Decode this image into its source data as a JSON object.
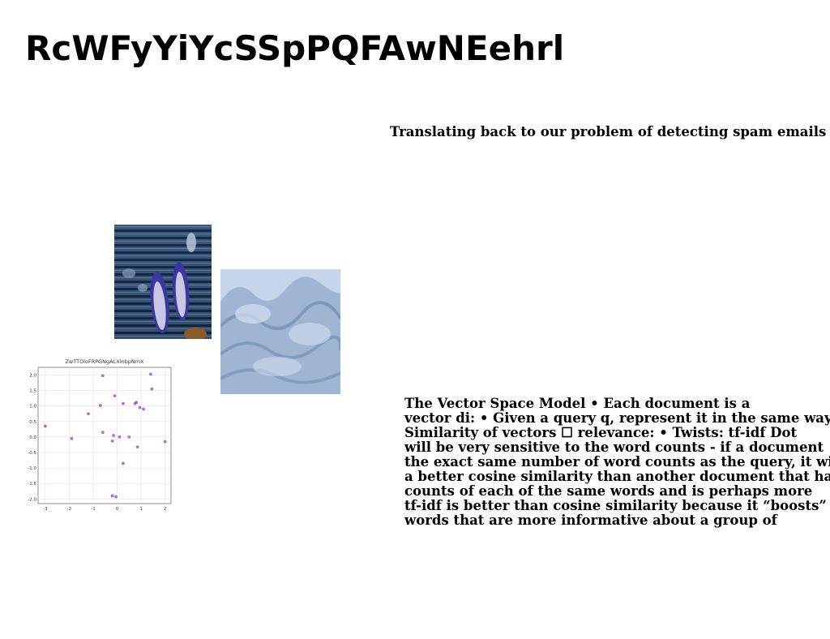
{
  "slide": {
    "title": "RcWFyYiYcSSpPQFAwNEehrl",
    "subtitle": "Translating back to our problem of detecting spam emails •",
    "body_lines": [
      "The Vector Space Model • Each document is a",
      "vector di: • Given a query q, represent it in the same way.",
      "Similarity of vectors ☐ relevance: • Twists:  tf-idf Dot",
      "will be very sensitive to the word counts - if a document",
      "the exact same number of word counts as the query, it will",
      "a better cosine similarity than another document that has",
      "counts of each of the same words and is perhaps more",
      "tf-idf is better than cosine similarity because it “boosts”",
      "words that are more informative about a group of"
    ]
  },
  "images": {
    "photo1_subject": "sneakers-on-wooden-boardwalk",
    "photo2_subject": "blue-snow-texture"
  },
  "chart_data": {
    "type": "scatter",
    "title": "ZwTTOloFRPGNgALXinbpNmX",
    "xlabel": "",
    "ylabel": "",
    "xlim": [
      -3.3,
      2.25
    ],
    "ylim": [
      -2.15,
      2.25
    ],
    "xticks": [
      -3,
      -2,
      -1,
      0,
      1,
      2
    ],
    "yticks": [
      -2.0,
      -1.5,
      -1.0,
      -0.5,
      0.0,
      0.5,
      1.0,
      1.5,
      2.0
    ],
    "grid": true,
    "color": "#9b59d0",
    "points": [
      {
        "x": -3.0,
        "y": 0.35
      },
      {
        "x": -1.9,
        "y": -0.05
      },
      {
        "x": -1.2,
        "y": 0.75
      },
      {
        "x": -0.7,
        "y": 1.02
      },
      {
        "x": -0.6,
        "y": 0.15
      },
      {
        "x": -0.6,
        "y": 1.98
      },
      {
        "x": -0.2,
        "y": -0.13
      },
      {
        "x": -0.15,
        "y": 0.05
      },
      {
        "x": -0.1,
        "y": 1.33
      },
      {
        "x": 0.1,
        "y": 0.0
      },
      {
        "x": 0.25,
        "y": 1.08
      },
      {
        "x": 0.25,
        "y": -0.85
      },
      {
        "x": 0.5,
        "y": 0.0
      },
      {
        "x": 0.75,
        "y": 1.08
      },
      {
        "x": 0.8,
        "y": 1.12
      },
      {
        "x": 0.85,
        "y": -0.32
      },
      {
        "x": 0.95,
        "y": 0.95
      },
      {
        "x": 1.1,
        "y": 0.9
      },
      {
        "x": 1.4,
        "y": 2.03
      },
      {
        "x": 1.45,
        "y": 1.55
      },
      {
        "x": 2.0,
        "y": -0.15
      },
      {
        "x": -0.2,
        "y": -1.9
      },
      {
        "x": -0.05,
        "y": -1.93
      }
    ]
  }
}
